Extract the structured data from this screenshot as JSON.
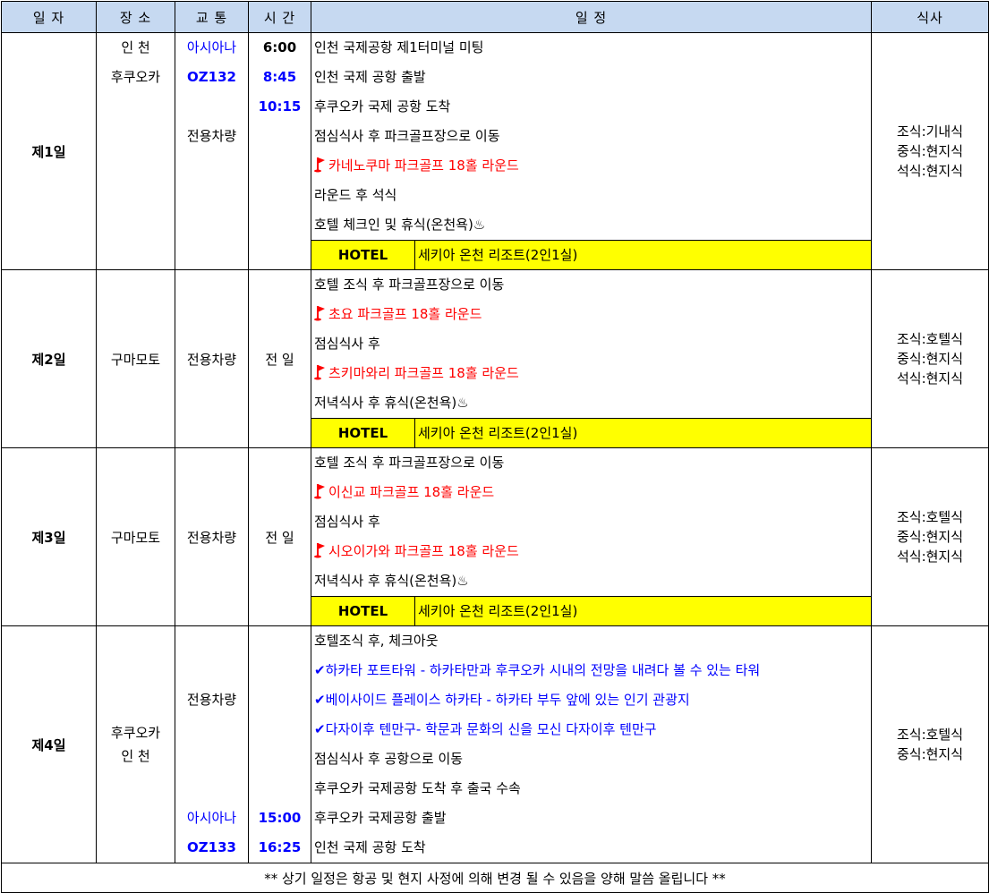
{
  "header": {
    "day": "일 자",
    "place": "장 소",
    "transport": "교 통",
    "time": "시 간",
    "schedule": "일 정",
    "meal": "식사"
  },
  "days": [
    {
      "label": "제1일",
      "place": [
        "인 천",
        "후쿠오카"
      ],
      "transport": [
        "아시아나",
        "OZ132",
        "",
        "전용차량"
      ],
      "time": [
        "6:00",
        "8:45",
        "10:15"
      ],
      "schedule": [
        "인천 국제공항 제1터미널 미팅",
        "인천 국제 공항 출발",
        "후쿠오카 국제 공항 도착",
        "점심식사 후 파크골프장으로 이동",
        "카네노쿠마 파크골프 18홀 라운드",
        "라운드 후 석식",
        "호텔 체크인 및 휴식(온천욕)♨"
      ],
      "hotel_label": "HOTEL",
      "hotel_name": "세키아 온천 리조트(2인1실)",
      "meals": [
        "조식:기내식",
        "중식:현지식",
        "석식:현지식"
      ]
    },
    {
      "label": "제2일",
      "place": "구마모토",
      "transport": "전용차량",
      "time": "전 일",
      "schedule": [
        "호텔 조식 후 파크골프장으로 이동",
        "초요 파크골프 18홀 라운드",
        "점심식사 후",
        "츠키마와리 파크골프 18홀 라운드",
        "저녁식사 후 휴식(온천욕)♨"
      ],
      "hotel_label": "HOTEL",
      "hotel_name": "세키아 온천 리조트(2인1실)",
      "meals": [
        "조식:호텔식",
        "중식:현지식",
        "석식:현지식"
      ]
    },
    {
      "label": "제3일",
      "place": "구마모토",
      "transport": "전용차량",
      "time": "전 일",
      "schedule": [
        "호텔 조식 후 파크골프장으로 이동",
        "이신교 파크골프 18홀 라운드",
        "점심식사 후",
        "시오이가와 파크골프 18홀 라운드",
        "저녁식사 후 휴식(온천욕)♨"
      ],
      "hotel_label": "HOTEL",
      "hotel_name": "세키아 온천 리조트(2인1실)",
      "meals": [
        "조식:호텔식",
        "중식:현지식",
        "석식:현지식"
      ]
    },
    {
      "label": "제4일",
      "place": [
        "후쿠오카",
        "인  천"
      ],
      "transport": [
        "전용차량",
        "아시아나",
        "OZ133"
      ],
      "time": [
        "15:00",
        "16:25"
      ],
      "schedule": [
        "호텔조식 후, 체크아웃",
        "✔하카타 포트타워 - 하카타만과 후쿠오카 시내의 전망을 내려다 볼 수 있는 타워",
        "✔베이사이드 플레이스 하카타 - 하카타 부두 앞에 있는 인기 관광지",
        "✔다자이후 텐만구- 학문과 문화의 신을 모신 다자이후 텐만구",
        "점심식사 후 공항으로 이동",
        "후쿠오카 국제공항 도착 후 출국 수속",
        "후쿠오카 국제공항 출발",
        "인천 국제 공항 도착"
      ],
      "meals": [
        "조식:호텔식",
        "중식:현지식"
      ]
    }
  ],
  "footer_note": "** 상기 일정은 항공 및 현지 사정에 의해 변경 될 수 있음을 양해 말씀 올립니다 **",
  "colors": {
    "header_bg": "#c6d9f1",
    "hotel_bg": "#ffff00",
    "accent_red": "#ff0000",
    "accent_blue": "#0000ff"
  },
  "icons": {
    "golf": "golf-flag-icon",
    "steam": "hot-spring-icon"
  }
}
